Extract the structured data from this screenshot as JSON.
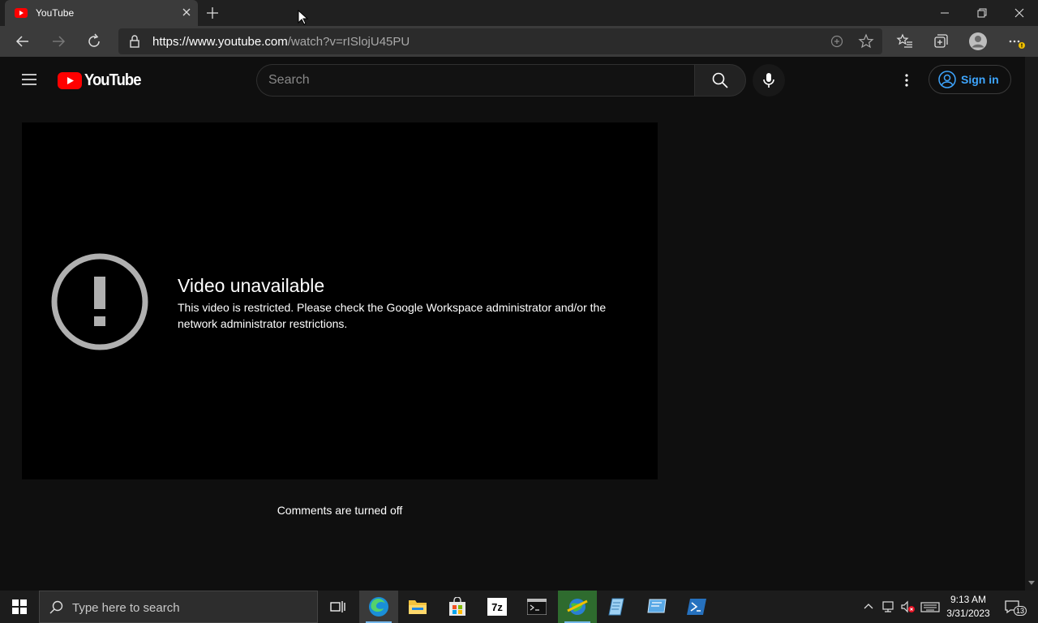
{
  "browser": {
    "tab_title": "YouTube",
    "url_host": "https://www.youtube.com",
    "url_path": "/watch?v=rISlojU45PU"
  },
  "youtube": {
    "logo_text": "YouTube",
    "search_placeholder": "Search",
    "signin_label": "Sign in",
    "accent_color": "#3ea6ff",
    "brand_red": "#ff0000"
  },
  "player": {
    "error_title": "Video unavailable",
    "error_message": "This video is restricted. Please check the Google Workspace administrator and/or the network administrator restrictions."
  },
  "comments": {
    "status": "Comments are turned off"
  },
  "taskbar": {
    "search_placeholder": "Type here to search",
    "apps": [
      "task-view",
      "edge",
      "file-explorer",
      "store",
      "7zip",
      "terminal",
      "network-app",
      "notepad-app",
      "remote-app",
      "powershell"
    ],
    "time": "9:13 AM",
    "date": "3/31/2023",
    "notification_count": "13"
  }
}
